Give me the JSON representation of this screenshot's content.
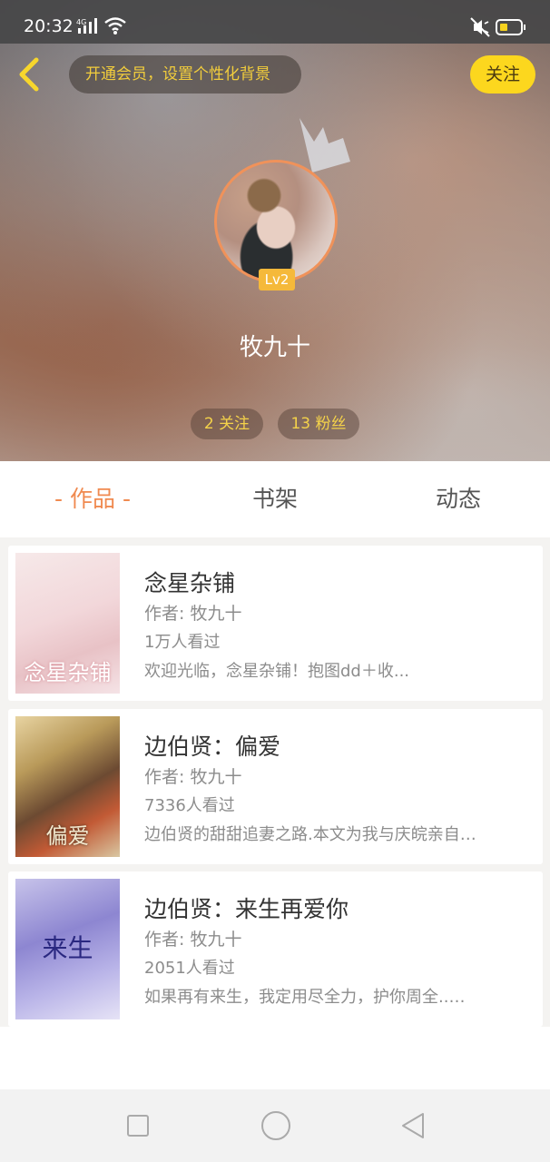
{
  "status_bar": {
    "time": "20:32",
    "network_label": "4G"
  },
  "header": {
    "vip_prompt": "开通会员，设置个性化背景",
    "follow_label": "关注",
    "level": "Lv2",
    "username": "牧九十",
    "following": "2 关注",
    "fans": "13 粉丝"
  },
  "tabs": {
    "works": "- 作品 -",
    "shelf": "书架",
    "feed": "动态"
  },
  "books": [
    {
      "title": "念星杂铺",
      "author": "作者: 牧九十",
      "views": "1万人看过",
      "desc": "欢迎光临，念星杂铺！抱图dd＋收...",
      "cover_text": "念星杂铺"
    },
    {
      "title": "边伯贤：偏爱",
      "author": "作者: 牧九十",
      "views": "7336人看过",
      "desc": "边伯贤的甜甜追妻之路.本文为我与庆皖亲自…",
      "cover_text": "偏爱"
    },
    {
      "title": "边伯贤：来生再爱你",
      "author": "作者: 牧九十",
      "views": "2051人看过",
      "desc": "如果再有来生，我定用尽全力，护你周全..…",
      "cover_text": "来生"
    }
  ],
  "colors": {
    "accent": "#f08a50",
    "follow_button": "#fcd71e",
    "stat_text": "#f4d24a"
  }
}
